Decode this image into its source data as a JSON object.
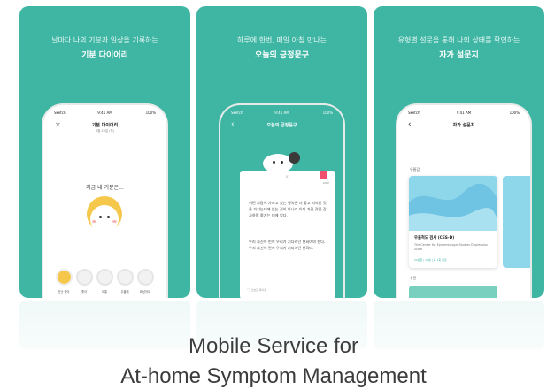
{
  "panels": [
    {
      "caption_top": "날마다 나의 기분과 일상을 기록하는",
      "caption_title": "기분 다이어리",
      "screen": {
        "status_left": "Sketch",
        "status_time": "9:41 AM",
        "status_right": "100%",
        "title": "기분 다이어리",
        "subtitle": "6월 20일 (목)",
        "prompt": "지금 내 기분은...",
        "moods": [
          "신난 좋아",
          "좋아",
          "보통",
          "우울해",
          "화났어요"
        ]
      }
    },
    {
      "caption_top": "하루에 한번, 매일 아침 만나는",
      "caption_title": "오늘의 긍정문구",
      "screen": {
        "status_left": "Sketch",
        "status_time": "9:41 AM",
        "status_right": "100%",
        "title": "오늘의 긍정문구",
        "card_badge": "SAVE",
        "card_number": "01",
        "para1": "어떤 사람이 가지고 있는 행복은 더 좋고 넉넉한 것을 가지는데에 있는 것이 아니라 이미 가진 것을 감사하며 즐기는 데에 있다.",
        "para2": "우리 자신이 먼저 우리가 기다리던 변화여야 한다. 우리 자신이 먼저 우리가 기다리던 변화다.",
        "footer": "오늘도 화이팅"
      }
    },
    {
      "caption_top": "유형별 설문을 통해 나의 상태를 확인하는",
      "caption_title": "자가 설문지",
      "screen": {
        "status_left": "Sketch",
        "status_time": "9:41 AM",
        "status_right": "100%",
        "title": "자가 설문지",
        "section1": "우울감",
        "card_title": "우울척도 검사 (CES-D)",
        "card_desc": "The Center for Epidemiologic Studies Depression Scale",
        "card_meta": "20문항 | 10분 | 총 1회 응답",
        "section2": "수면"
      }
    }
  ],
  "caption": {
    "line1": "Mobile Service for",
    "line2": "At-home Symptom Management"
  },
  "colors": {
    "accent": "#3fb6a4",
    "mood_yellow": "#f5c84c",
    "card_blue": "#7ecfe8"
  }
}
